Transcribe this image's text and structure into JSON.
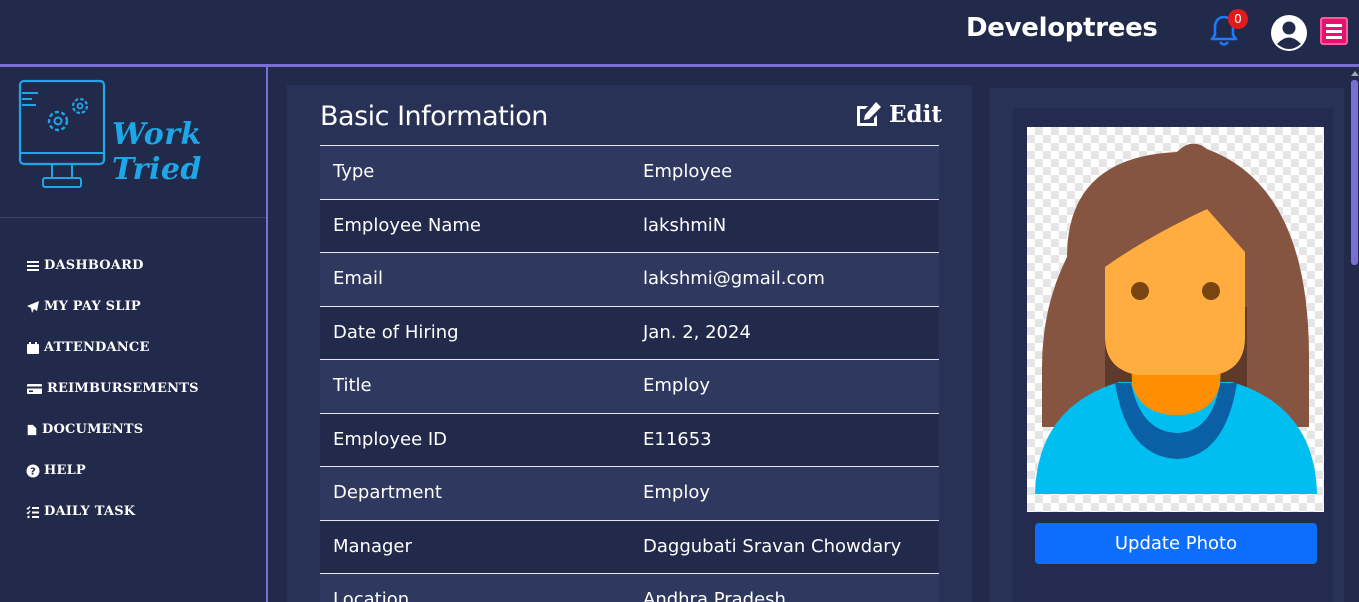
{
  "header": {
    "brand": "Developtrees",
    "notification_count": "0"
  },
  "sidebar": {
    "logo_text": "Work Tried",
    "items": [
      {
        "label": "DASHBOARD",
        "icon": "bars-icon"
      },
      {
        "label": "MY PAY SLIP",
        "icon": "paper-plane-icon"
      },
      {
        "label": "ATTENDANCE",
        "icon": "calendar-icon"
      },
      {
        "label": "REIMBURSEMENTS",
        "icon": "credit-card-icon"
      },
      {
        "label": "DOCUMENTS",
        "icon": "file-icon"
      },
      {
        "label": "HELP",
        "icon": "question-circle-icon"
      },
      {
        "label": "DAILY TASK",
        "icon": "tasks-icon"
      }
    ]
  },
  "main": {
    "title": "Basic Information",
    "edit_label": "Edit",
    "rows": [
      {
        "label": "Type",
        "value": "Employee"
      },
      {
        "label": "Employee Name",
        "value": "lakshmiN"
      },
      {
        "label": "Email",
        "value": "lakshmi@gmail.com"
      },
      {
        "label": "Date of Hiring",
        "value": "Jan. 2, 2024"
      },
      {
        "label": "Title",
        "value": "Employ"
      },
      {
        "label": "Employee ID",
        "value": "E11653"
      },
      {
        "label": "Department",
        "value": "Employ"
      },
      {
        "label": "Manager",
        "value": "Daggubati Sravan Chowdary"
      },
      {
        "label": "Location",
        "value": "Andhra Pradesh"
      }
    ]
  },
  "photo": {
    "update_label": "Update Photo"
  },
  "colors": {
    "background": "#212a4a",
    "card": "#283156",
    "accent": "#7a6fd6",
    "primary_button": "#0d6efd",
    "badge": "#e11b1b",
    "menu_button": "#e1156e",
    "logo": "#1ea7e8"
  }
}
